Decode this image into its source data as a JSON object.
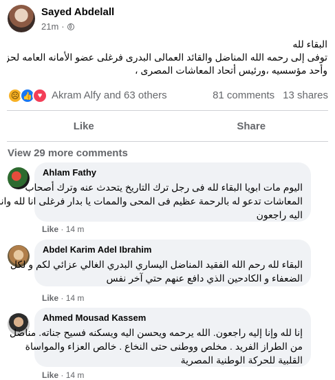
{
  "post": {
    "author": "Sayed Abdelall",
    "time": "21m",
    "dot": "·",
    "privacy_icon": "globe-icon",
    "lines": [
      "البقاء لله",
      "توفى إلى رحمه الله المناضل والقائد العمالى البدرى فرغلى عضو الأمانه العامه لحزب التجمع",
      "وأحد مؤسسيه ،ورئيس أتحاد المعاشات المصرى ،"
    ]
  },
  "reactions": {
    "icons": [
      "sad-emoji-icon",
      "like-icon",
      "love-icon"
    ],
    "names": "Akram Alfy and 63 others",
    "comments_count": "81 comments",
    "shares_count": "13 shares"
  },
  "actions": {
    "like": "Like",
    "share": "Share"
  },
  "view_more": "View 29 more comments",
  "comments": [
    {
      "name": "Ahlam Fathy",
      "lines": [
        "اليوم مات ابويا البقاء لله فى رجل ترك التاريخ يتحدث عنه وترك أصحاب",
        "المعاشات تدعو له بالرحمة عظيم فى المحى والممات يا بدار فرغلى انا لله وانا",
        "اليه راجعون"
      ],
      "like": "Like",
      "time": "14 m"
    },
    {
      "name": "Abdel Karim Adel Ibrahim",
      "lines": [
        "البقاء لله رحم الله الفقيد المناضل اليساري البدري الغالي عزائي لكم و لكل",
        "الضعفاء و الكادحين الذي دافع عنهم حتي آخر نفس"
      ],
      "like": "Like",
      "time": "14 m"
    },
    {
      "name": "Ahmed Mousad Kassem",
      "lines": [
        "إنا لله وإنا إليه راجعون. الله يرحمه ويحسن اليه ويسكنه فسيح جناته. مناضل",
        "من الطراز الفريد . مخلص ووطنى حتى النخاع . خالص العزاء والمواساة",
        "القلبية للحركة الوطنية المصرية"
      ],
      "like": "Like",
      "time": "14 m"
    }
  ]
}
